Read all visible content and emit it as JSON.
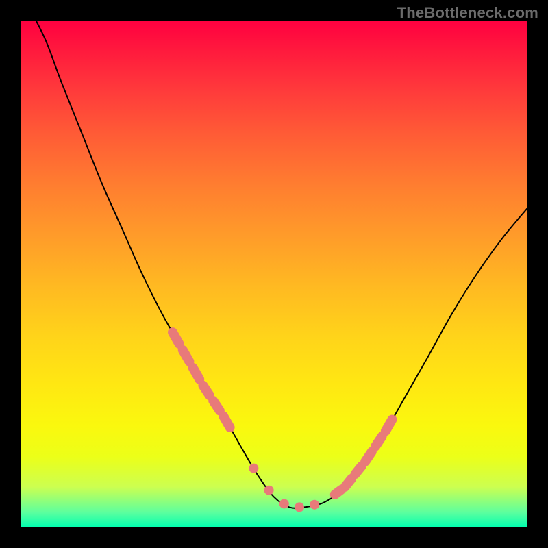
{
  "watermark": "TheBottleneck.com",
  "chart_data": {
    "type": "line",
    "title": "",
    "xlabel": "",
    "ylabel": "",
    "xlim": [
      0,
      100
    ],
    "ylim": [
      0,
      100
    ],
    "series": [
      {
        "name": "curve",
        "x": [
          2,
          5,
          8,
          12,
          16,
          20,
          24,
          28,
          32,
          36,
          40,
          44,
          47,
          50,
          53,
          56,
          60,
          64,
          68,
          72,
          76,
          80,
          85,
          90,
          95,
          100
        ],
        "values": [
          102,
          96,
          88,
          78,
          68,
          59,
          50,
          42,
          35,
          28,
          22,
          15,
          10,
          6,
          4,
          4,
          5,
          8,
          13,
          19,
          26,
          33,
          42,
          50,
          57,
          63
        ]
      }
    ],
    "highlight_ranges": [
      {
        "side": "left",
        "x_from": 30,
        "x_to": 42
      },
      {
        "side": "right",
        "x_from": 62,
        "x_to": 74
      }
    ],
    "highlight_color": "#e87a7a",
    "floor_points_x": [
      46,
      49,
      52,
      55,
      58
    ],
    "colors": {
      "gradient_top": "#ff0040",
      "gradient_bottom": "#00ffb0",
      "curve": "#000000"
    }
  }
}
